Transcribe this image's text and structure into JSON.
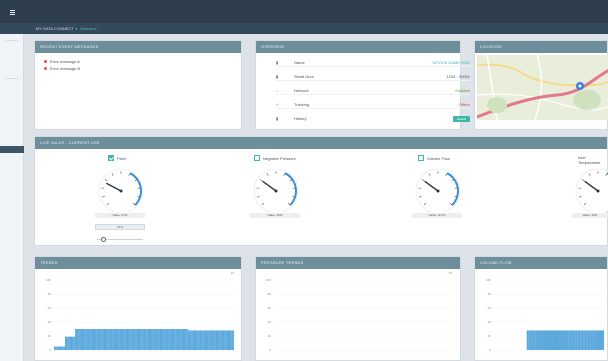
{
  "breadcrumb": {
    "root": "MY DATA CONNECT",
    "separator": "▸",
    "current": "Overview"
  },
  "panels": {
    "messages": {
      "title": "RECENT EVENT MESSAGES",
      "items": [
        "Error message A",
        "Error message B"
      ]
    },
    "overview": {
      "title": "OVERVIEW",
      "rows": [
        {
          "icon": "device-icon",
          "label": "Name",
          "value": "DEVICE NAME 0001",
          "style": "teal"
        },
        {
          "icon": "serial-icon",
          "label": "Serial Num",
          "value": "1234 - 00001",
          "style": "plain"
        },
        {
          "icon": "network-icon",
          "label": "Network",
          "value": "Enabled",
          "style": "ok"
        },
        {
          "icon": "tracking-icon",
          "label": "Tracking",
          "value": "Offline",
          "style": "off"
        },
        {
          "icon": "history-icon",
          "label": "History",
          "value": "Details",
          "style": "button"
        }
      ]
    },
    "location": {
      "title": "LOCATION"
    },
    "live": {
      "title": "LIVE VALUE - CURRENT USE",
      "gauges": [
        {
          "label": "Pitch",
          "checked": true,
          "readout": "Value: 27%",
          "level": 0.27,
          "input_value": "27%"
        },
        {
          "label": "Negative Pressure",
          "checked": false,
          "readout": "Value: 30%",
          "level": 0.3
        },
        {
          "label": "Volume Flow",
          "checked": false,
          "readout": "Value: 0m³/h",
          "level": 0.3
        },
        {
          "label": "Inlet Temperature",
          "checked": false,
          "readout": "Value: 30%",
          "level": 0.3
        }
      ]
    },
    "trends": [
      {
        "title": "TRENDS",
        "corner": "30"
      },
      {
        "title": "PRESSURE TRENDS",
        "corner": "30"
      },
      {
        "title": "VOLUME FLOW",
        "corner": ""
      }
    ]
  },
  "colors": {
    "accent": "#3fb6a8",
    "panel_header": "#6d8e9b",
    "topbar": "#2f3e4d",
    "bars": "#5aa8dc"
  },
  "chart_data": [
    {
      "type": "bar",
      "title": "TRENDS",
      "yticks": [
        "100",
        "80",
        "60",
        "40",
        "20",
        "0"
      ],
      "ylim": [
        0,
        100
      ],
      "values": [
        5,
        5,
        5,
        5,
        5,
        5,
        5,
        5,
        5,
        5,
        5,
        5,
        19,
        19,
        19,
        19,
        19,
        19,
        19,
        19,
        19,
        19,
        19,
        30,
        30,
        30,
        30,
        30,
        30,
        30,
        30,
        30,
        30,
        30,
        30,
        30,
        30,
        30,
        30,
        30,
        30,
        30,
        30,
        30,
        30,
        30,
        30,
        30,
        30,
        30,
        30,
        30,
        30,
        30,
        30,
        30,
        30,
        30,
        30,
        30,
        30,
        30,
        30,
        30,
        30,
        30,
        30,
        30,
        30,
        30,
        30,
        30,
        30,
        30,
        30,
        30,
        30,
        30,
        30,
        30,
        30,
        30,
        30,
        30,
        30,
        30,
        30,
        30,
        30,
        30,
        30,
        30,
        30,
        30,
        30,
        30,
        30,
        30,
        30,
        30,
        30,
        30,
        30,
        30,
        30,
        30,
        30,
        30,
        30,
        30,
        30,
        30,
        30,
        30,
        30,
        30,
        30,
        30,
        30,
        30,
        30,
        30,
        30,
        30,
        30,
        30,
        30,
        30,
        30,
        30,
        30,
        30,
        30,
        30,
        30,
        30,
        30,
        30,
        30,
        30,
        30,
        30,
        30,
        30,
        30,
        30,
        28,
        28,
        28,
        28,
        28,
        28,
        28,
        28,
        28,
        28,
        28,
        28,
        28,
        28,
        28,
        28,
        28,
        28,
        28,
        28,
        28,
        28,
        28,
        28,
        28,
        28,
        28,
        28,
        28,
        28,
        28,
        28,
        28,
        28,
        28,
        28,
        28,
        28,
        28,
        28,
        28,
        28,
        28,
        28,
        28,
        28,
        28,
        28,
        28,
        28
      ]
    },
    {
      "type": "bar",
      "title": "PRESSURE TRENDS",
      "yticks": [
        "100",
        "80",
        "60",
        "40",
        "20",
        "0"
      ],
      "ylim": [
        0,
        100
      ],
      "values": []
    },
    {
      "type": "bar",
      "title": "VOLUME FLOW",
      "yticks": [
        "100",
        "80",
        "60",
        "40",
        "20",
        "0"
      ],
      "ylim": [
        0,
        100
      ],
      "values": [
        0,
        0,
        0,
        0,
        0,
        0,
        0,
        0,
        0,
        0,
        0,
        0,
        0,
        0,
        0,
        0,
        0,
        0,
        0,
        0,
        0,
        0,
        28,
        28,
        28,
        28,
        28,
        28,
        28,
        28,
        28,
        28,
        28,
        28,
        28,
        28,
        28,
        28,
        28,
        28,
        28,
        28,
        28,
        28,
        28,
        28,
        28,
        28,
        28,
        28,
        28,
        28,
        28,
        28,
        28,
        28,
        28,
        28,
        28,
        28,
        28,
        28,
        28,
        28,
        28,
        28,
        28,
        28,
        28,
        28,
        28,
        28,
        28,
        28
      ]
    }
  ]
}
